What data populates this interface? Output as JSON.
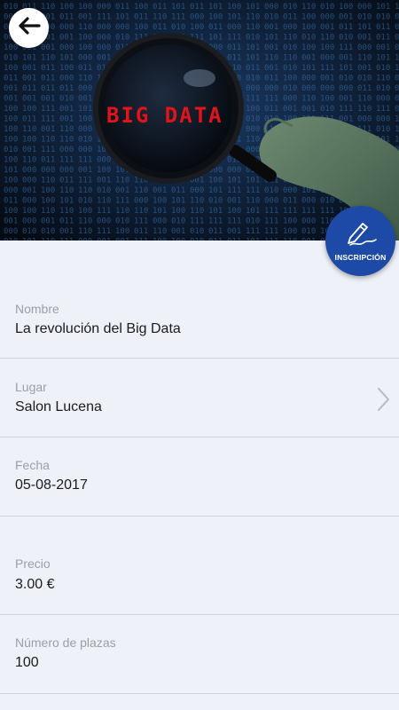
{
  "hero": {
    "image_text": "BIG DATA",
    "image_description_icon": "magnifying-glass-icon"
  },
  "header": {
    "back_icon": "arrow-left-icon"
  },
  "fab": {
    "label": "INSCRIPCIÓN",
    "icon": "pen-signature-icon",
    "color": "#1d4aa6"
  },
  "details": {
    "nombre": {
      "label": "Nombre",
      "value": "La revolución del Big Data"
    },
    "lugar": {
      "label": "Lugar",
      "value": "Salon Lucena"
    },
    "fecha": {
      "label": "Fecha",
      "value": "05-08-2017"
    },
    "precio": {
      "label": "Precio",
      "value": "3.00 €"
    },
    "plazas": {
      "label": "Número de plazas",
      "value": "100"
    }
  },
  "colors": {
    "background": "#eef1f8",
    "label": "#9a9ea6",
    "value": "#1b1b1b",
    "divider": "#cdd1d8"
  }
}
